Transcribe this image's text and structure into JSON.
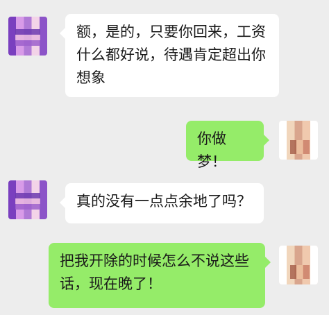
{
  "chat": {
    "messages": [
      {
        "side": "left",
        "text": "额，是的，只要你回来，工资什么都好说，待遇肯定超出你想象",
        "avatar": "contact-avatar"
      },
      {
        "side": "right",
        "text": "你做梦！",
        "avatar": "self-avatar"
      },
      {
        "side": "left",
        "text": "真的没有一点点余地了吗？",
        "avatar": "contact-avatar"
      },
      {
        "side": "right",
        "text": "把我开除的时候怎么不说这些话，现在晚了！",
        "avatar": "self-avatar"
      }
    ]
  },
  "colors": {
    "background": "#ededed",
    "incoming_bubble": "#ffffff",
    "outgoing_bubble": "#95ec69",
    "text": "#191919"
  }
}
